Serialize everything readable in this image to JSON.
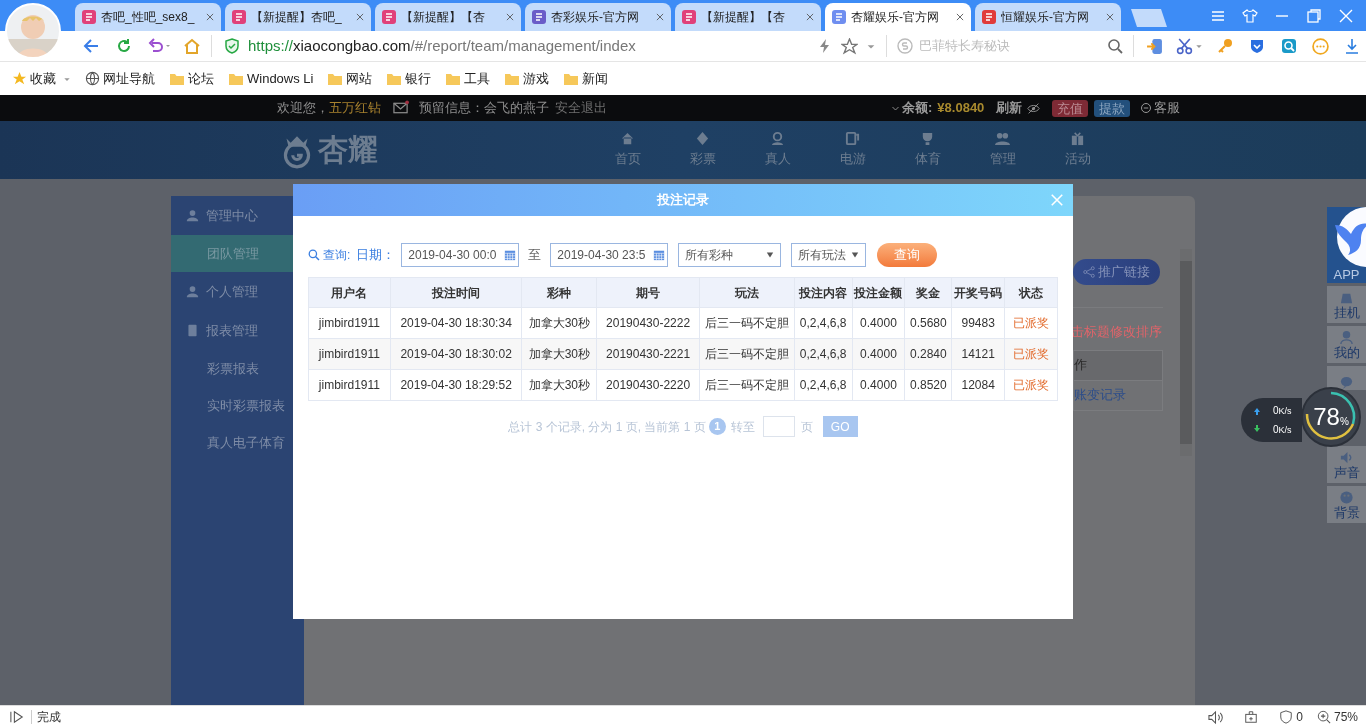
{
  "browser": {
    "tabs": [
      {
        "title": "杏吧_性吧_sex8_",
        "color": "#e0407a",
        "selected": false
      },
      {
        "title": "【新提醒】杏吧_",
        "color": "#e0407a",
        "selected": false
      },
      {
        "title": "【新提醒】【杏",
        "color": "#e0407a",
        "selected": false
      },
      {
        "title": "杏彩娱乐-官方网",
        "color": "#6a5cc8",
        "selected": false
      },
      {
        "title": "【新提醒】【杏",
        "color": "#e0407a",
        "selected": false
      },
      {
        "title": "杏耀娱乐-官方网",
        "color": "#6f8ef0",
        "selected": true
      },
      {
        "title": "恒耀娱乐-官方网",
        "color": "#e03a3a",
        "selected": false
      }
    ],
    "address": {
      "scheme": "https://",
      "host": "xiaocongbao.com",
      "path": "/#/report/team/management/index"
    },
    "search": {
      "placeholder": "巴菲特长寿秘诀"
    },
    "bookmarks": [
      "收藏",
      "网址导航",
      "论坛",
      "Windows Li",
      "网站",
      "银行",
      "工具",
      "游戏",
      "新闻"
    ],
    "status_bar": {
      "text": "完成",
      "ad_count": "0",
      "zoom": "75%"
    }
  },
  "site": {
    "top_bar": {
      "welcome": "欢迎您，",
      "user": "五万红钻",
      "reserved_info": "预留信息：会飞的燕子",
      "logout": "安全退出",
      "balance_label": "余额:",
      "balance": "¥8.0840",
      "refresh": "刷新",
      "deposit": "充值",
      "withdraw": "提款",
      "service": "客服"
    },
    "logo": "杏耀",
    "nav": [
      "首页",
      "彩票",
      "真人",
      "电游",
      "体育",
      "管理",
      "活动"
    ],
    "sidebar": [
      {
        "label": "管理中心",
        "kind": "group",
        "selected": false
      },
      {
        "label": "团队管理",
        "kind": "item",
        "selected": true
      },
      {
        "label": "个人管理",
        "kind": "group",
        "selected": false
      },
      {
        "label": "报表管理",
        "kind": "group",
        "selected": false
      },
      {
        "label": "彩票报表",
        "kind": "item",
        "selected": false
      },
      {
        "label": "实时彩票报表",
        "kind": "item",
        "selected": false
      },
      {
        "label": "真人电子体育",
        "kind": "item",
        "selected": false
      }
    ],
    "content": {
      "promo_link": "推广链接",
      "sort_hint": "击标题修改排序",
      "table_header": "作",
      "table_link": "账变记录"
    },
    "dock": [
      {
        "label": "APP",
        "selected": true
      },
      {
        "label": "挂机",
        "selected": false
      },
      {
        "label": "我的",
        "selected": false
      },
      {
        "selected": false
      },
      {
        "label": "声音",
        "selected": false
      },
      {
        "label": "背景",
        "selected": false
      }
    ],
    "speed": {
      "up": "0",
      "up_unit": "K/s",
      "down": "0",
      "down_unit": "K/s",
      "percent": "78",
      "percent_sign": "%"
    }
  },
  "modal": {
    "title": "投注记录",
    "filter": {
      "query_label": "查询:",
      "date_label": "日期：",
      "start": "2019-04-30 00:0",
      "to": "至",
      "end": "2019-04-30 23:5",
      "lottery": "所有彩种",
      "play": "所有玩法",
      "submit": "查询"
    },
    "columns": [
      "用户名",
      "投注时间",
      "彩种",
      "期号",
      "玩法",
      "投注内容",
      "投注金额",
      "奖金",
      "开奖号码",
      "状态"
    ],
    "rows": [
      [
        "jimbird1911",
        "2019-04-30 18:30:34",
        "加拿大30秒",
        "20190430-2222",
        "后三一码不定胆",
        "0,2,4,6,8",
        "0.4000",
        "0.5680",
        "99483",
        "已派奖"
      ],
      [
        "jimbird1911",
        "2019-04-30 18:30:02",
        "加拿大30秒",
        "20190430-2221",
        "后三一码不定胆",
        "0,2,4,6,8",
        "0.4000",
        "0.2840",
        "14121",
        "已派奖"
      ],
      [
        "jimbird1911",
        "2019-04-30 18:29:52",
        "加拿大30秒",
        "20190430-2220",
        "后三一码不定胆",
        "0,2,4,6,8",
        "0.4000",
        "0.8520",
        "12084",
        "已派奖"
      ]
    ],
    "pagination": {
      "summary": "总计 3 个记录, 分为 1 页, 当前第 1 页",
      "current": "1",
      "goto": "转至",
      "unit": "页",
      "go": "GO"
    }
  }
}
